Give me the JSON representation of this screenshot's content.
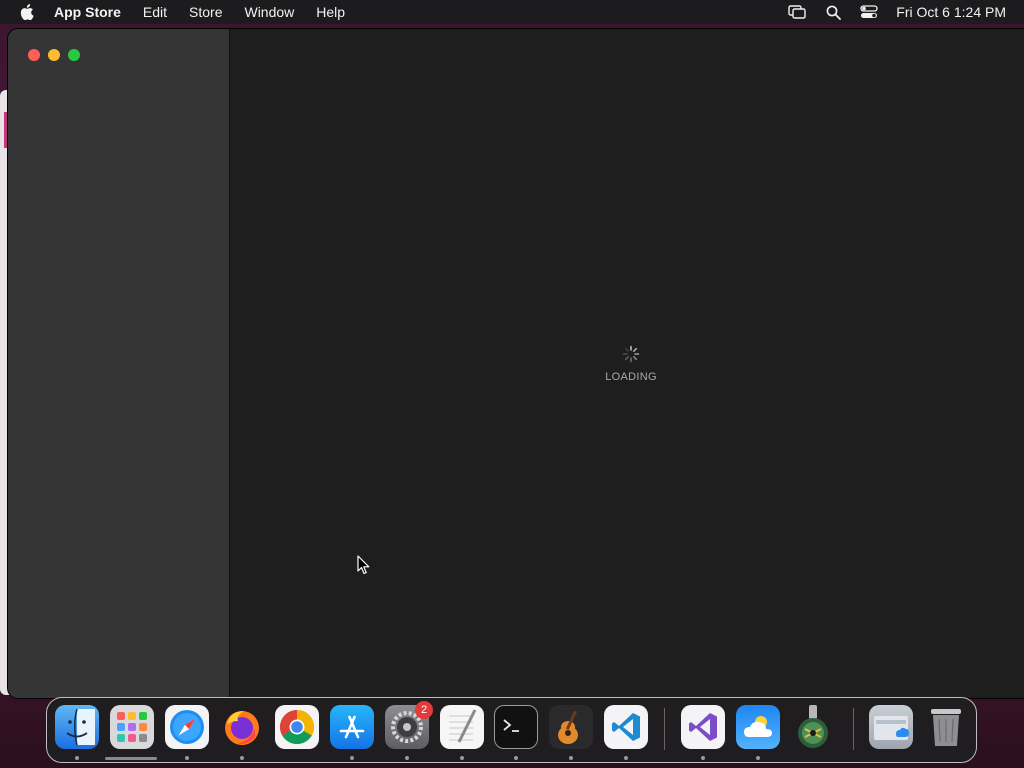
{
  "menubar": {
    "app_name": "App Store",
    "menus": [
      "Edit",
      "Store",
      "Window",
      "Help"
    ],
    "clock": "Fri Oct 6  1:24 PM"
  },
  "content": {
    "loading_label": "LOADING"
  },
  "dock": {
    "settings_badge": "2"
  },
  "colors": {
    "menubar": "#1c1c1e",
    "sidebar": "#353535",
    "content": "#1e1e1e",
    "close": "#ff5f57",
    "minimize": "#febc2e",
    "maximize": "#28c840"
  }
}
